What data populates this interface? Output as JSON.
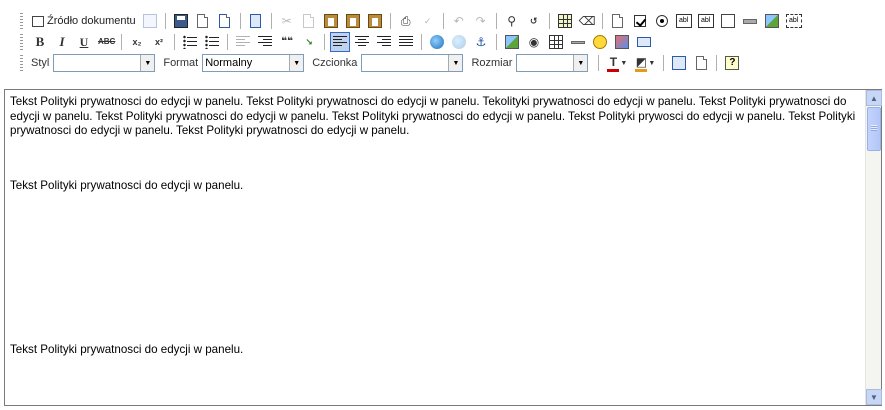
{
  "toolbar": {
    "source_label": "Źródło dokumentu",
    "style_label": "Styl",
    "style_value": "",
    "format_label": "Format",
    "format_value": "Normalny",
    "font_label": "Czcionka",
    "font_value": "",
    "size_label": "Rozmiar",
    "size_value": "",
    "glyphs": {
      "bold": "B",
      "italic": "I",
      "underline": "U",
      "strike": "ABC",
      "subscript": "x₂",
      "superscript": "x²",
      "blockquote": "❝❝",
      "text_color": "T",
      "qmark": "?",
      "field_text": "abl"
    }
  },
  "editor": {
    "paragraph_1": "Tekst Polityki prywatnosci do edycji w panelu. Tekst Polityki prywatnosci do edycji w panelu. Tekolityki prywatnosci do edycji w panelu. Tekst Polityki prywatnosci do edycji w panelu. Tekst Polityki prywatnosci do edycji w panelu. Tekst Polityki prywatnosci do edycji w panelu. Tekst Polityki prywosci do edycji w panelu. Tekst Polityki prywatnosci do edycji w panelu. Tekst Polityki prywatnosci do edycji w panelu.",
    "paragraph_2": "Tekst Polityki prywatnosci do edycji w panelu.",
    "paragraph_3": "Tekst Polityki prywatnosci do edycji w panelu."
  },
  "colors": {
    "active_button_bg": "#c1d2ee",
    "active_button_border": "#316ac5",
    "scrollbar": "#c3d3fd",
    "editor_border": "#7a7a7a"
  },
  "icons": [
    "source-icon",
    "preview-template-icon",
    "save-icon",
    "new-page-icon",
    "preview-icon",
    "templates-icon",
    "cut-icon",
    "copy-icon",
    "paste-icon",
    "paste-text-icon",
    "paste-word-icon",
    "print-icon",
    "spellcheck-icon",
    "undo-icon",
    "redo-icon",
    "find-icon",
    "replace-icon",
    "select-all-icon",
    "remove-format-icon",
    "form-icon",
    "checkbox-icon",
    "radio-icon",
    "textfield-icon",
    "textarea-icon",
    "select-icon",
    "button-icon",
    "image-button-icon",
    "hidden-field-icon"
  ]
}
